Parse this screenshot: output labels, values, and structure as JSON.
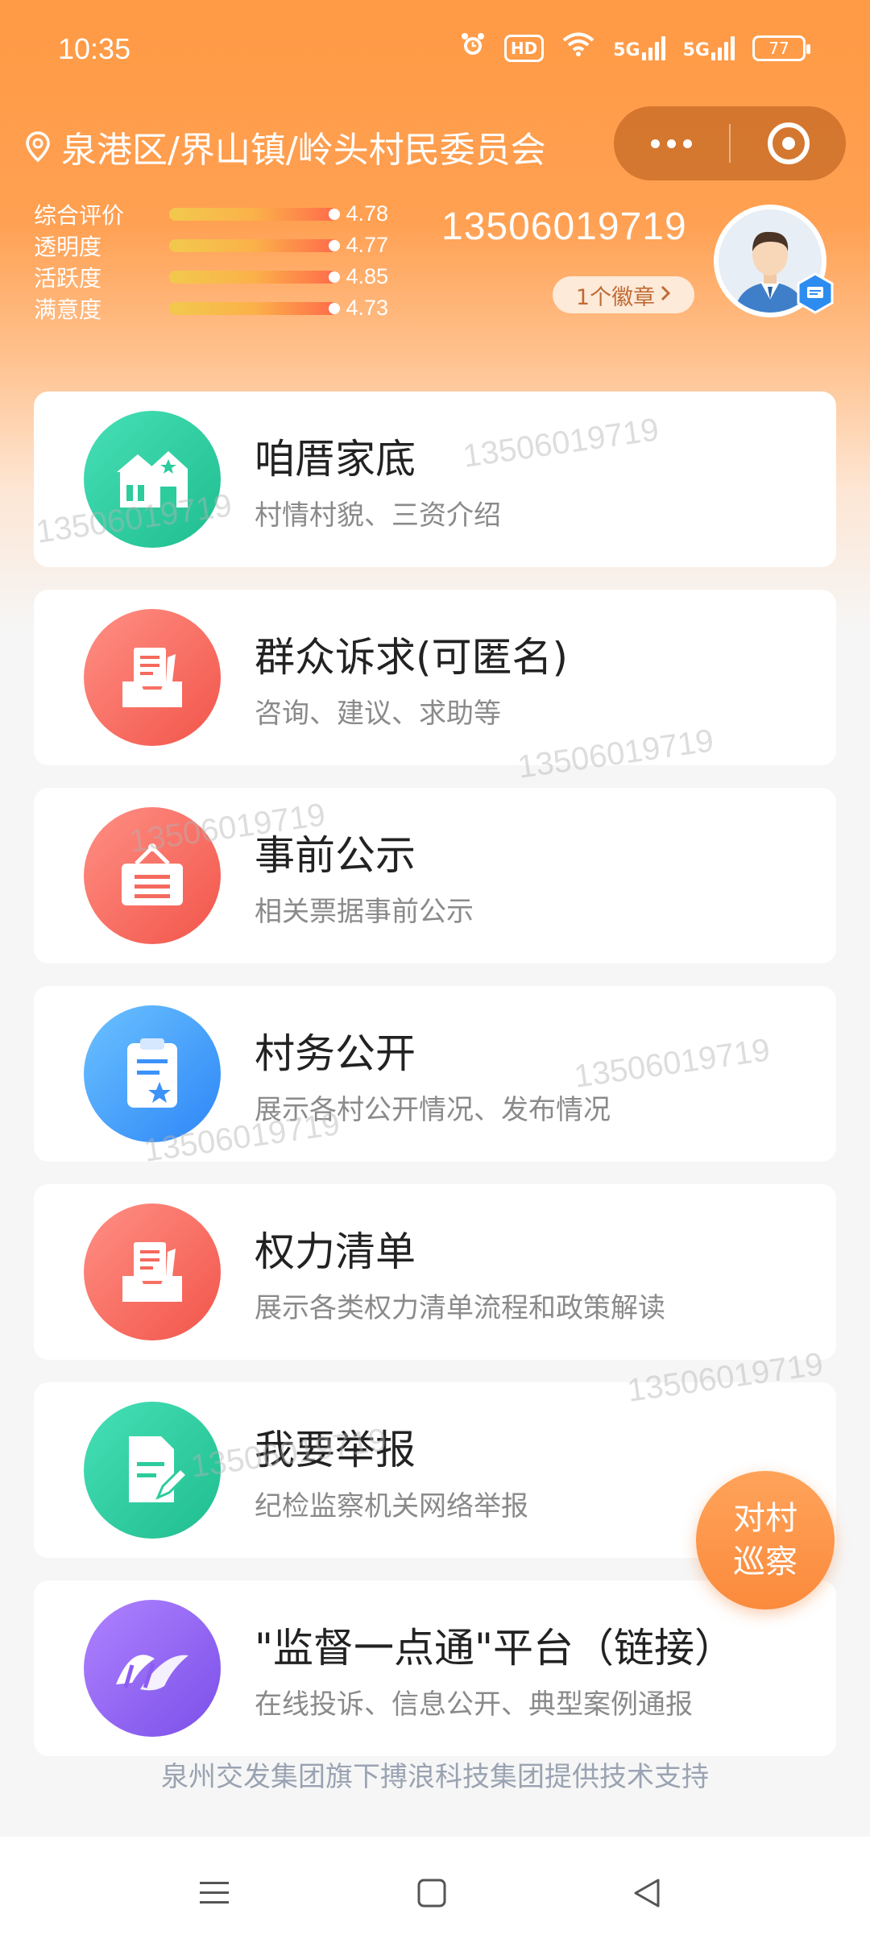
{
  "status_bar": {
    "time": "10:35",
    "hd_label": "HD",
    "sim1_label": "5G",
    "sim2_label": "5G",
    "battery": "77"
  },
  "header": {
    "location": "泉港区/界山镇/岭头村民委员会",
    "phone": "13506019719",
    "badge_label": "1个徽章",
    "ratings": [
      {
        "label": "综合评价",
        "value": "4.78"
      },
      {
        "label": "透明度",
        "value": "4.77"
      },
      {
        "label": "活跃度",
        "value": "4.85"
      },
      {
        "label": "满意度",
        "value": "4.73"
      }
    ]
  },
  "cards": [
    {
      "title": "咱厝家底",
      "subtitle": "村情村貌、三资介绍",
      "icon": "house-icon",
      "color": "green"
    },
    {
      "title": "群众诉求(可匿名)",
      "subtitle": "咨询、建议、求助等",
      "icon": "inbox-document-icon",
      "color": "red"
    },
    {
      "title": "事前公示",
      "subtitle": "相关票据事前公示",
      "icon": "notice-board-icon",
      "color": "red"
    },
    {
      "title": "村务公开",
      "subtitle": "展示各村公开情况、发布情况",
      "icon": "clipboard-star-icon",
      "color": "blue"
    },
    {
      "title": "权力清单",
      "subtitle": "展示各类权力清单流程和政策解读",
      "icon": "inbox-document-icon",
      "color": "red"
    },
    {
      "title": "我要举报",
      "subtitle": "纪检监察机关网络举报",
      "icon": "document-edit-icon",
      "color": "green"
    },
    {
      "title": "\"监督一点通\"平台（链接）",
      "subtitle": "在线投诉、信息公开、典型案例通报",
      "icon": "platform-logo-icon",
      "color": "purple"
    }
  ],
  "float_button": {
    "line1": "对村",
    "line2": "巡察"
  },
  "footer": "泉州交发集团旗下搏浪科技集团提供技术支持",
  "watermark": "13506019719"
}
